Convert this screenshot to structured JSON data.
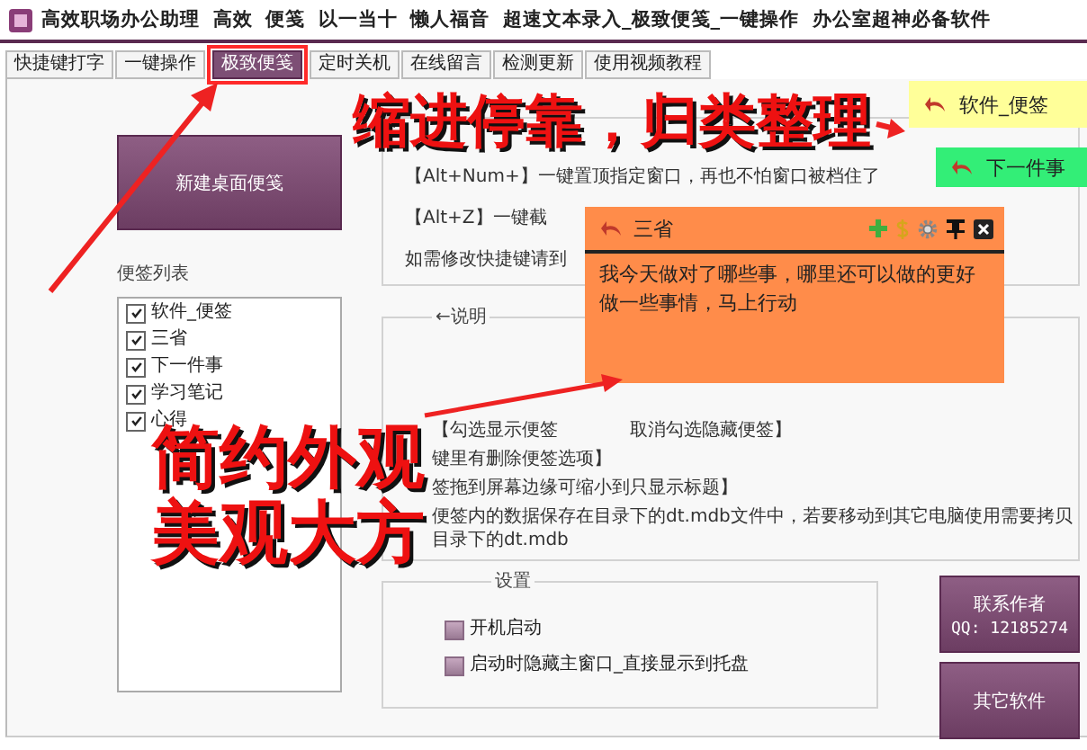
{
  "window": {
    "title": "高效职场办公助理  高效  便笺  以一当十  懒人福音  超速文本录入_极致便笺_一键操作  办公室超神必备软件"
  },
  "tabs": [
    {
      "label": "快捷键打字",
      "selected": false,
      "highlighted": false
    },
    {
      "label": "一键操作",
      "selected": false,
      "highlighted": false
    },
    {
      "label": "极致便笺",
      "selected": true,
      "highlighted": true
    },
    {
      "label": "定时关机",
      "selected": false,
      "highlighted": false
    },
    {
      "label": "在线留言",
      "selected": false,
      "highlighted": false
    },
    {
      "label": "检测更新",
      "selected": false,
      "highlighted": false
    },
    {
      "label": "使用视频教程",
      "selected": false,
      "highlighted": false
    }
  ],
  "new_note_button": "新建桌面便笺",
  "note_list": {
    "label": "便签列表",
    "items": [
      {
        "label": "软件_便签",
        "checked": true
      },
      {
        "label": "三省",
        "checked": true
      },
      {
        "label": "下一件事",
        "checked": true
      },
      {
        "label": "学习笔记",
        "checked": true
      },
      {
        "label": "心得",
        "checked": true
      }
    ]
  },
  "hotkeys": {
    "lines": [
      "【Alt+Num+】一键置顶指定窗口，再也不怕窗口被档住了",
      "【Alt+Z】一键截",
      "如需修改快捷键请到"
    ]
  },
  "help": {
    "title": "←说明",
    "lines": [
      [
        "【勾选显示便签",
        "取消勾选隐藏便签】"
      ],
      [
        "键里有删除便签选项】"
      ],
      [
        "签拖到屏幕边缘可缩小到只显示标题】"
      ],
      [
        "便签内的数据保存在目录下的dt.mdb文件中，若要移动到其它电脑使用需要拷贝目录下的dt.mdb"
      ]
    ]
  },
  "settings": {
    "title": "设置",
    "options": [
      {
        "label": "开机启动",
        "checked": false
      },
      {
        "label": "启动时隐藏主窗口_直接显示到托盘",
        "checked": false
      }
    ]
  },
  "contact_button": {
    "label": "联系作者",
    "qq": "QQ: 12185274"
  },
  "other_software_button": "其它软件",
  "sticky_notes": [
    {
      "kind": "collapsed",
      "title": "软件_便签",
      "color": "#ffff99"
    },
    {
      "kind": "collapsed",
      "title": "下一件事",
      "color": "#33ee77"
    },
    {
      "kind": "expanded",
      "title": "三省",
      "color": "#ff8c4a",
      "body": [
        "我今天做对了哪些事，哪里还可以做的更好",
        "做一些事情，马上行动"
      ]
    }
  ],
  "annotations": [
    {
      "text": "缩进停靠，归类整理"
    },
    {
      "text": "简约外观"
    },
    {
      "text": "美观大方"
    }
  ]
}
